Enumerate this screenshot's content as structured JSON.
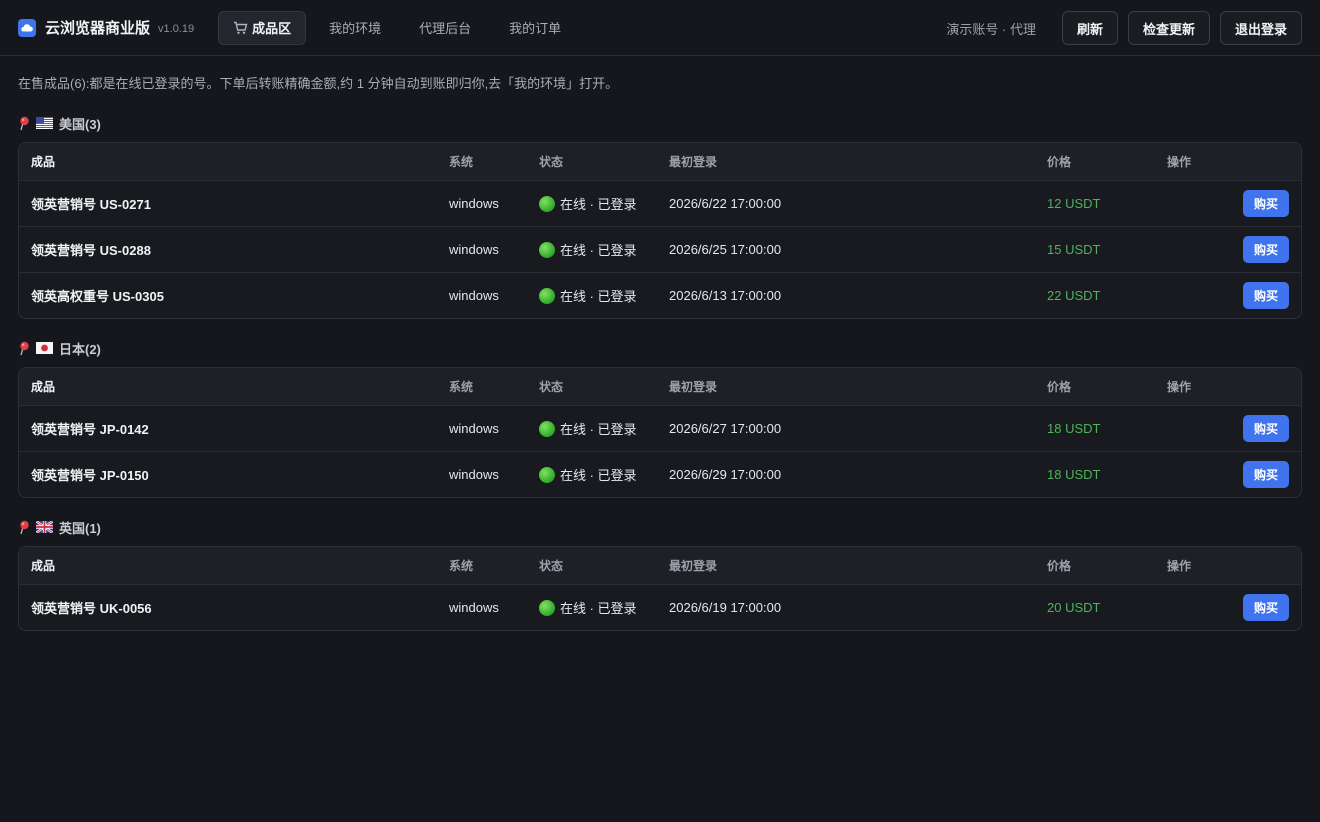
{
  "header": {
    "app_title": "云浏览器商业版",
    "version": "v1.0.19",
    "tabs": [
      {
        "label": "成品区",
        "icon": "cart-icon",
        "active": true
      },
      {
        "label": "我的环境"
      },
      {
        "label": "代理后台"
      },
      {
        "label": "我的订单"
      }
    ],
    "account": "演示账号 · 代理",
    "buttons": {
      "refresh": "刷新",
      "check_update": "检查更新",
      "logout": "退出登录"
    }
  },
  "notice": "在售成品(6):都是在线已登录的号。下单后转账精确金额,约 1 分钟自动到账即归你,去「我的环境」打开。",
  "columns": {
    "product": "成品",
    "system": "系统",
    "status": "状态",
    "first_login": "最初登录",
    "price": "价格",
    "action": "操作"
  },
  "buy_label": "购买",
  "regions": [
    {
      "title": "美国(3)",
      "flag": "us-flag-icon",
      "rows": [
        {
          "product": "领英营销号 US-0271",
          "system": "windows",
          "status": "在线 · 已登录",
          "first_login": "2026/6/22 17:00:00",
          "price": "12 USDT"
        },
        {
          "product": "领英营销号 US-0288",
          "system": "windows",
          "status": "在线 · 已登录",
          "first_login": "2026/6/25 17:00:00",
          "price": "15 USDT"
        },
        {
          "product": "领英高权重号 US-0305",
          "system": "windows",
          "status": "在线 · 已登录",
          "first_login": "2026/6/13 17:00:00",
          "price": "22 USDT"
        }
      ]
    },
    {
      "title": "日本(2)",
      "flag": "jp-flag-icon",
      "rows": [
        {
          "product": "领英营销号 JP-0142",
          "system": "windows",
          "status": "在线 · 已登录",
          "first_login": "2026/6/27 17:00:00",
          "price": "18 USDT"
        },
        {
          "product": "领英营销号 JP-0150",
          "system": "windows",
          "status": "在线 · 已登录",
          "first_login": "2026/6/29 17:00:00",
          "price": "18 USDT"
        }
      ]
    },
    {
      "title": "英国(1)",
      "flag": "uk-flag-icon",
      "rows": [
        {
          "product": "领英营销号 UK-0056",
          "system": "windows",
          "status": "在线 · 已登录",
          "first_login": "2026/6/19 17:00:00",
          "price": "20 USDT"
        }
      ]
    }
  ],
  "colors": {
    "accent": "#3f74ee",
    "price": "#4fb35b",
    "background": "#15171c"
  }
}
